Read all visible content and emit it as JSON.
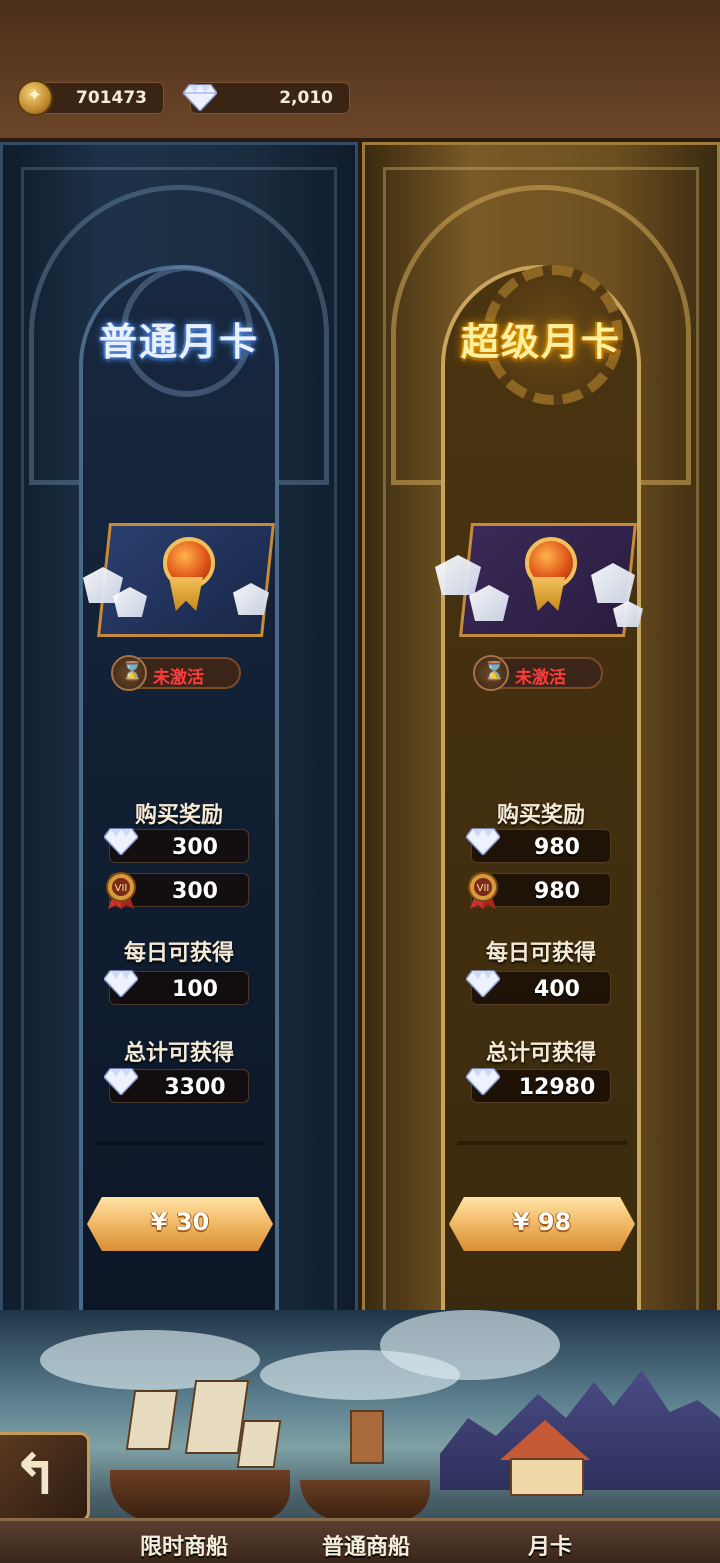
{
  "currency": {
    "gold": "701473",
    "gems": "2,010"
  },
  "cards": [
    {
      "title": "普通月卡",
      "status": "未激活",
      "purchase_label": "购买奖励",
      "purchase_gems": "300",
      "purchase_vip": "300",
      "daily_label": "每日可获得",
      "daily_gems": "100",
      "total_label": "总计可获得",
      "total_gems": "3300",
      "price": "¥ 30"
    },
    {
      "title": "超级月卡",
      "status": "未激活",
      "purchase_label": "购买奖励",
      "purchase_gems": "980",
      "purchase_vip": "980",
      "daily_label": "每日可获得",
      "daily_gems": "400",
      "total_label": "总计可获得",
      "total_gems": "12980",
      "price": "¥ 98"
    }
  ],
  "nav": {
    "tabs": [
      "限时商船",
      "普通商船",
      "月卡"
    ]
  },
  "colors": {
    "normal_panel": "#1d3249",
    "super_panel": "#7a5a26",
    "inactive_status": "#ff3c3c",
    "price_button": "#f1b865"
  },
  "icons": {
    "gold": "gold-coin-icon",
    "gem": "diamond-gem-icon",
    "vip": "vip-medal-icon",
    "status": "hourglass-icon",
    "back": "back-arrow-icon"
  }
}
